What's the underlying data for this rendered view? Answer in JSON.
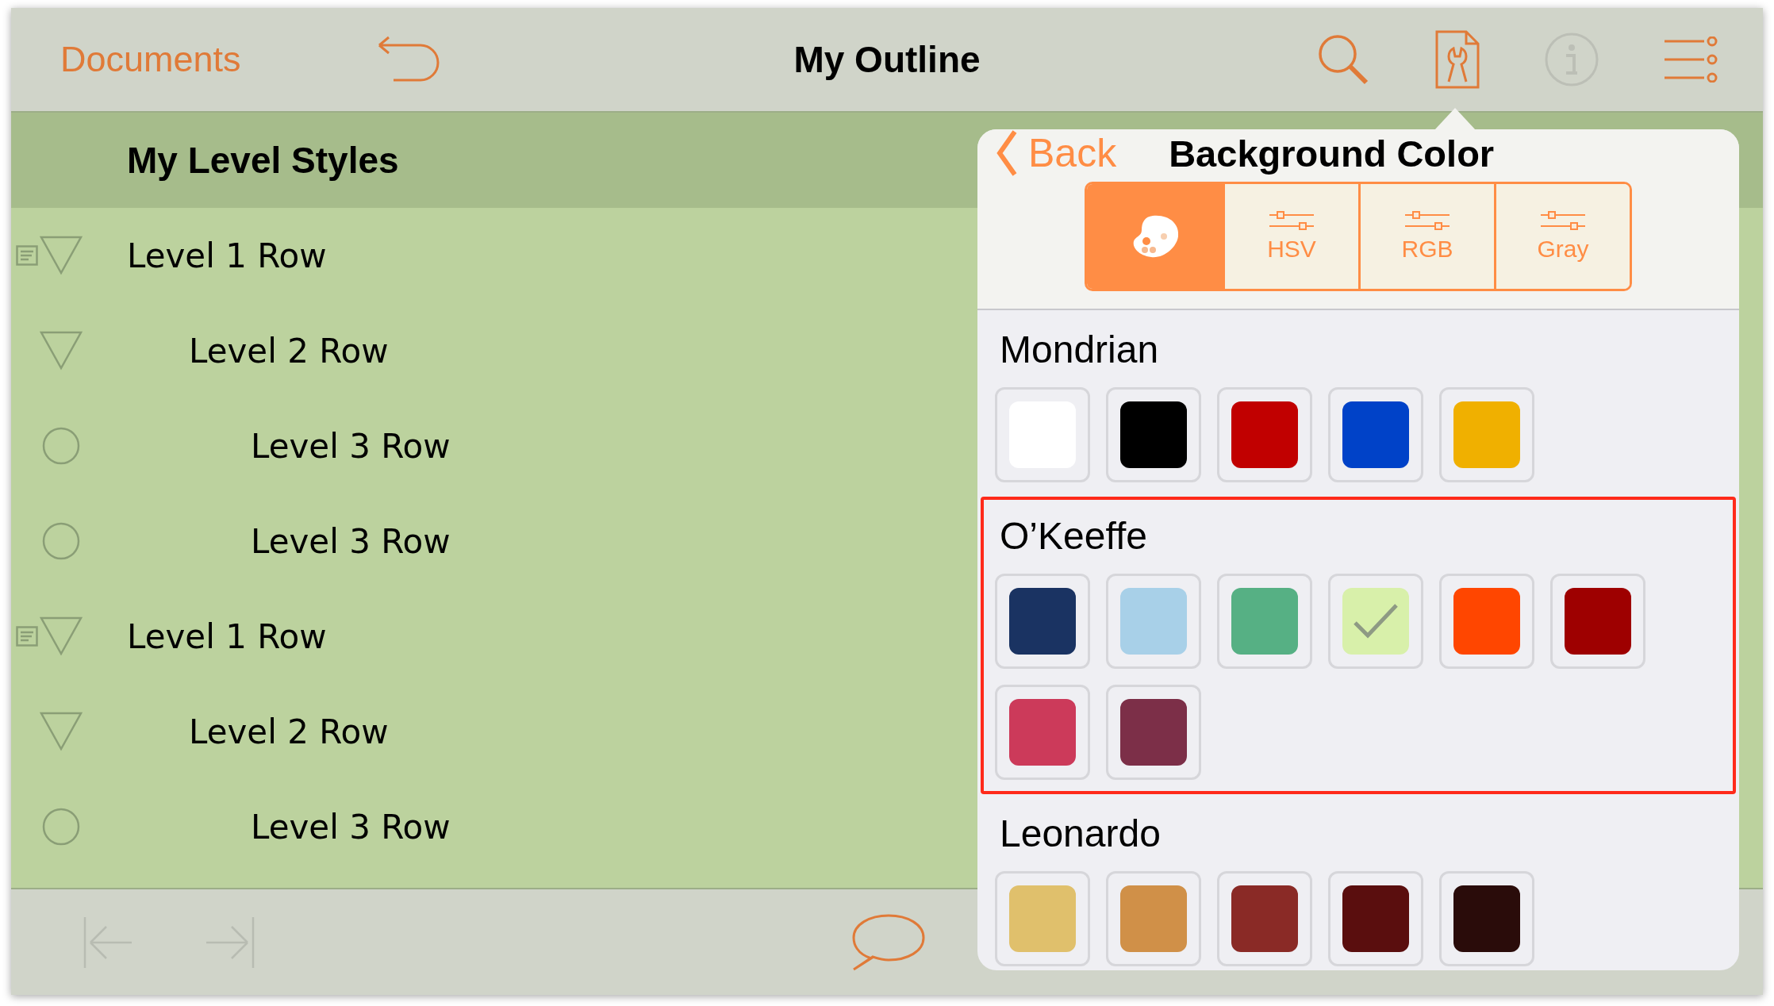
{
  "toolbar": {
    "documents": "Documents",
    "title": "My Outline"
  },
  "outline": {
    "heading": "My Level Styles",
    "rows": [
      {
        "label": "Level 1 Row",
        "note": true,
        "expanded": true,
        "children": [
          {
            "label": "Level 2 Row",
            "expanded": true,
            "children": [
              {
                "label": "Level 3 Row"
              },
              {
                "label": "Level 3 Row"
              }
            ]
          }
        ]
      },
      {
        "label": "Level 1 Row",
        "note": true,
        "expanded": true,
        "children": [
          {
            "label": "Level 2 Row",
            "expanded": true,
            "children": [
              {
                "label": "Level 3 Row"
              }
            ]
          }
        ]
      }
    ]
  },
  "popover": {
    "back": "Back",
    "title": "Background Color",
    "modes": [
      {
        "kind": "palette",
        "selected": true
      },
      {
        "kind": "sliders",
        "label": "HSV",
        "selected": false
      },
      {
        "kind": "sliders",
        "label": "RGB",
        "selected": false
      },
      {
        "kind": "sliders",
        "label": "Gray",
        "selected": false
      }
    ],
    "palettes": [
      {
        "name": "Mondrian",
        "highlighted": false,
        "swatches": [
          {
            "color": "#ffffff",
            "selected": false
          },
          {
            "color": "#000000",
            "selected": false
          },
          {
            "color": "#c10000",
            "selected": false
          },
          {
            "color": "#0042c8",
            "selected": false
          },
          {
            "color": "#f0b000",
            "selected": false
          }
        ]
      },
      {
        "name": "O’Keeffe",
        "highlighted": true,
        "swatches": [
          {
            "color": "#1a3362",
            "selected": false
          },
          {
            "color": "#a8d0e8",
            "selected": false
          },
          {
            "color": "#56b084",
            "selected": false
          },
          {
            "color": "#d8f0aa",
            "selected": true
          },
          {
            "color": "#ff4600",
            "selected": false
          },
          {
            "color": "#9e0000",
            "selected": false
          },
          {
            "color": "#cc3a5a",
            "selected": false
          },
          {
            "color": "#7c2f48",
            "selected": false
          }
        ]
      },
      {
        "name": "Leonardo",
        "highlighted": false,
        "swatches": [
          {
            "color": "#e0c06c",
            "selected": false
          },
          {
            "color": "#d09048",
            "selected": false
          },
          {
            "color": "#8a2a26",
            "selected": false
          },
          {
            "color": "#5a0e0e",
            "selected": false
          },
          {
            "color": "#2a0c0a",
            "selected": false
          }
        ]
      }
    ]
  }
}
